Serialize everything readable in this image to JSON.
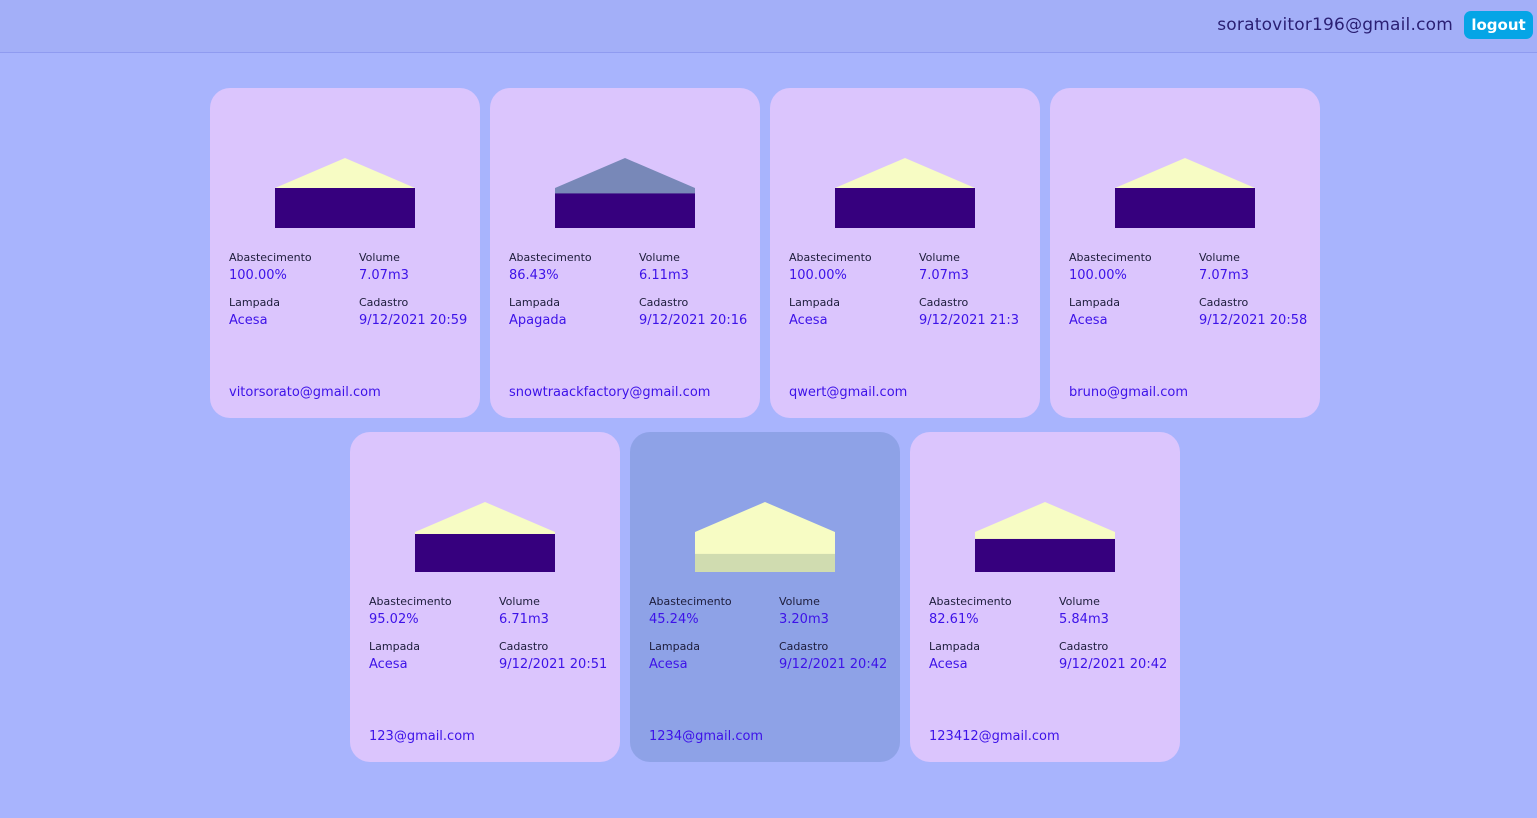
{
  "header": {
    "user_email": "soratovitor196@gmail.com",
    "logout_label": "logout"
  },
  "labels": {
    "abastecimento": "Abastecimento",
    "volume": "Volume",
    "lampada": "Lampada",
    "cadastro": "Cadastro"
  },
  "colors": {
    "page_background": "#a8b4fd",
    "card_background": "#dbc5fd",
    "card_selected_background": "#8ea2e7",
    "water": "#36007e",
    "lamp_on": "#f7fcc4",
    "lamp_off": "#7888b8",
    "water_light": "#d0dcb0",
    "value_text": "#3d12e8",
    "logout_button": "#05a5e6"
  },
  "cards": [
    {
      "abastecimento": "100.00%",
      "fill_fraction": 1.0,
      "volume": "7.07m3",
      "lampada": "Acesa",
      "lamp_on": true,
      "cadastro": "9/12/2021 20:59",
      "owner": "vitorsorato@gmail.com",
      "selected": false
    },
    {
      "abastecimento": "86.43%",
      "fill_fraction": 0.8643,
      "volume": "6.11m3",
      "lampada": "Apagada",
      "lamp_on": false,
      "cadastro": "9/12/2021 20:16",
      "owner": "snowtraackfactory@gmail.com",
      "selected": false
    },
    {
      "abastecimento": "100.00%",
      "fill_fraction": 1.0,
      "volume": "7.07m3",
      "lampada": "Acesa",
      "lamp_on": true,
      "cadastro": "9/12/2021 21:3",
      "owner": "qwert@gmail.com",
      "selected": false
    },
    {
      "abastecimento": "100.00%",
      "fill_fraction": 1.0,
      "volume": "7.07m3",
      "lampada": "Acesa",
      "lamp_on": true,
      "cadastro": "9/12/2021 20:58",
      "owner": "bruno@gmail.com",
      "selected": false
    },
    {
      "abastecimento": "95.02%",
      "fill_fraction": 0.9502,
      "volume": "6.71m3",
      "lampada": "Acesa",
      "lamp_on": true,
      "cadastro": "9/12/2021 20:51",
      "owner": "123@gmail.com",
      "selected": false
    },
    {
      "abastecimento": "45.24%",
      "fill_fraction": 0.4524,
      "volume": "3.20m3",
      "lampada": "Acesa",
      "lamp_on": true,
      "cadastro": "9/12/2021 20:42",
      "owner": "1234@gmail.com",
      "selected": true
    },
    {
      "abastecimento": "82.61%",
      "fill_fraction": 0.8261,
      "volume": "5.84m3",
      "lampada": "Acesa",
      "lamp_on": true,
      "cadastro": "9/12/2021 20:42",
      "owner": "123412@gmail.com",
      "selected": false
    }
  ]
}
